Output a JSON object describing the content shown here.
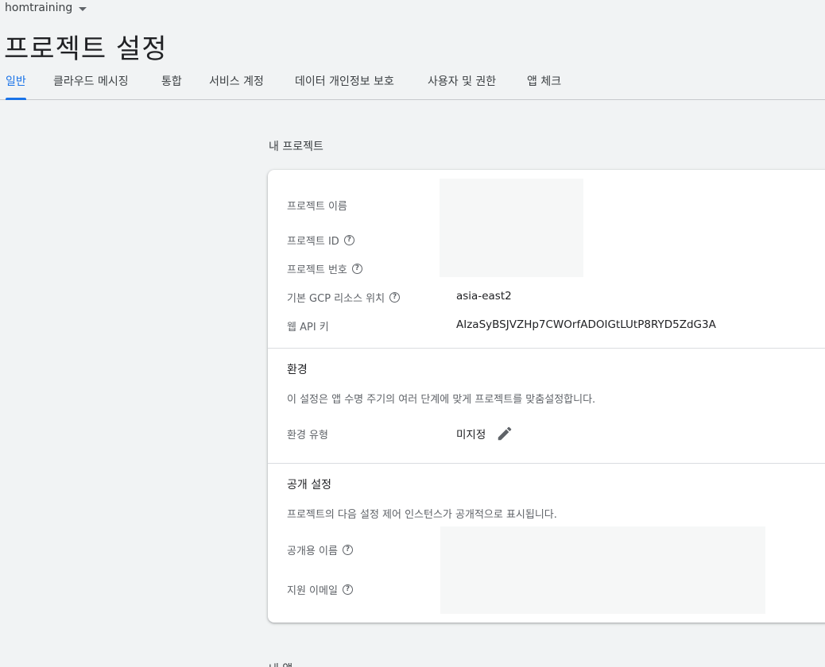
{
  "header": {
    "project_name": "homtraining",
    "page_title": "프로젝트 설정"
  },
  "tabs": [
    {
      "label": "일반",
      "active": true
    },
    {
      "label": "클라우드 메시징",
      "active": false
    },
    {
      "label": "통합",
      "active": false
    },
    {
      "label": "서비스 계정",
      "active": false
    },
    {
      "label": "데이터 개인정보 보호",
      "active": false
    },
    {
      "label": "사용자 및 권한",
      "active": false
    },
    {
      "label": "앱 체크",
      "active": false
    }
  ],
  "my_project": {
    "section_label": "내 프로젝트",
    "rows": {
      "project_name_label": "프로젝트 이름",
      "project_id_label": "프로젝트 ID",
      "project_number_label": "프로젝트 번호",
      "gcp_location_label": "기본 GCP 리소스 위치",
      "gcp_location_value": "asia-east2",
      "web_api_key_label": "웹 API 키",
      "web_api_key_value": "AIzaSyBSJVZHp7CWOrfADOIGtLUtP8RYD5ZdG3A"
    }
  },
  "environment": {
    "title": "환경",
    "description": "이 설정은 앱 수명 주기의 여러 단계에 맞게 프로젝트를 맞춤설정합니다.",
    "type_label": "환경 유형",
    "type_value": "미지정"
  },
  "public_settings": {
    "title": "공개 설정",
    "description": "프로젝트의 다음 설정 제어 인스턴스가 공개적으로 표시됩니다.",
    "public_name_label": "공개용 이름",
    "support_email_label": "지원 이메일"
  },
  "next_section_label": "내 앱",
  "icons": {
    "help": "help-circle-icon",
    "edit": "pencil-icon",
    "dropdown": "caret-down-icon"
  },
  "colors": {
    "accent": "#1a73e8",
    "background": "#f1f3f4",
    "card": "#ffffff"
  }
}
